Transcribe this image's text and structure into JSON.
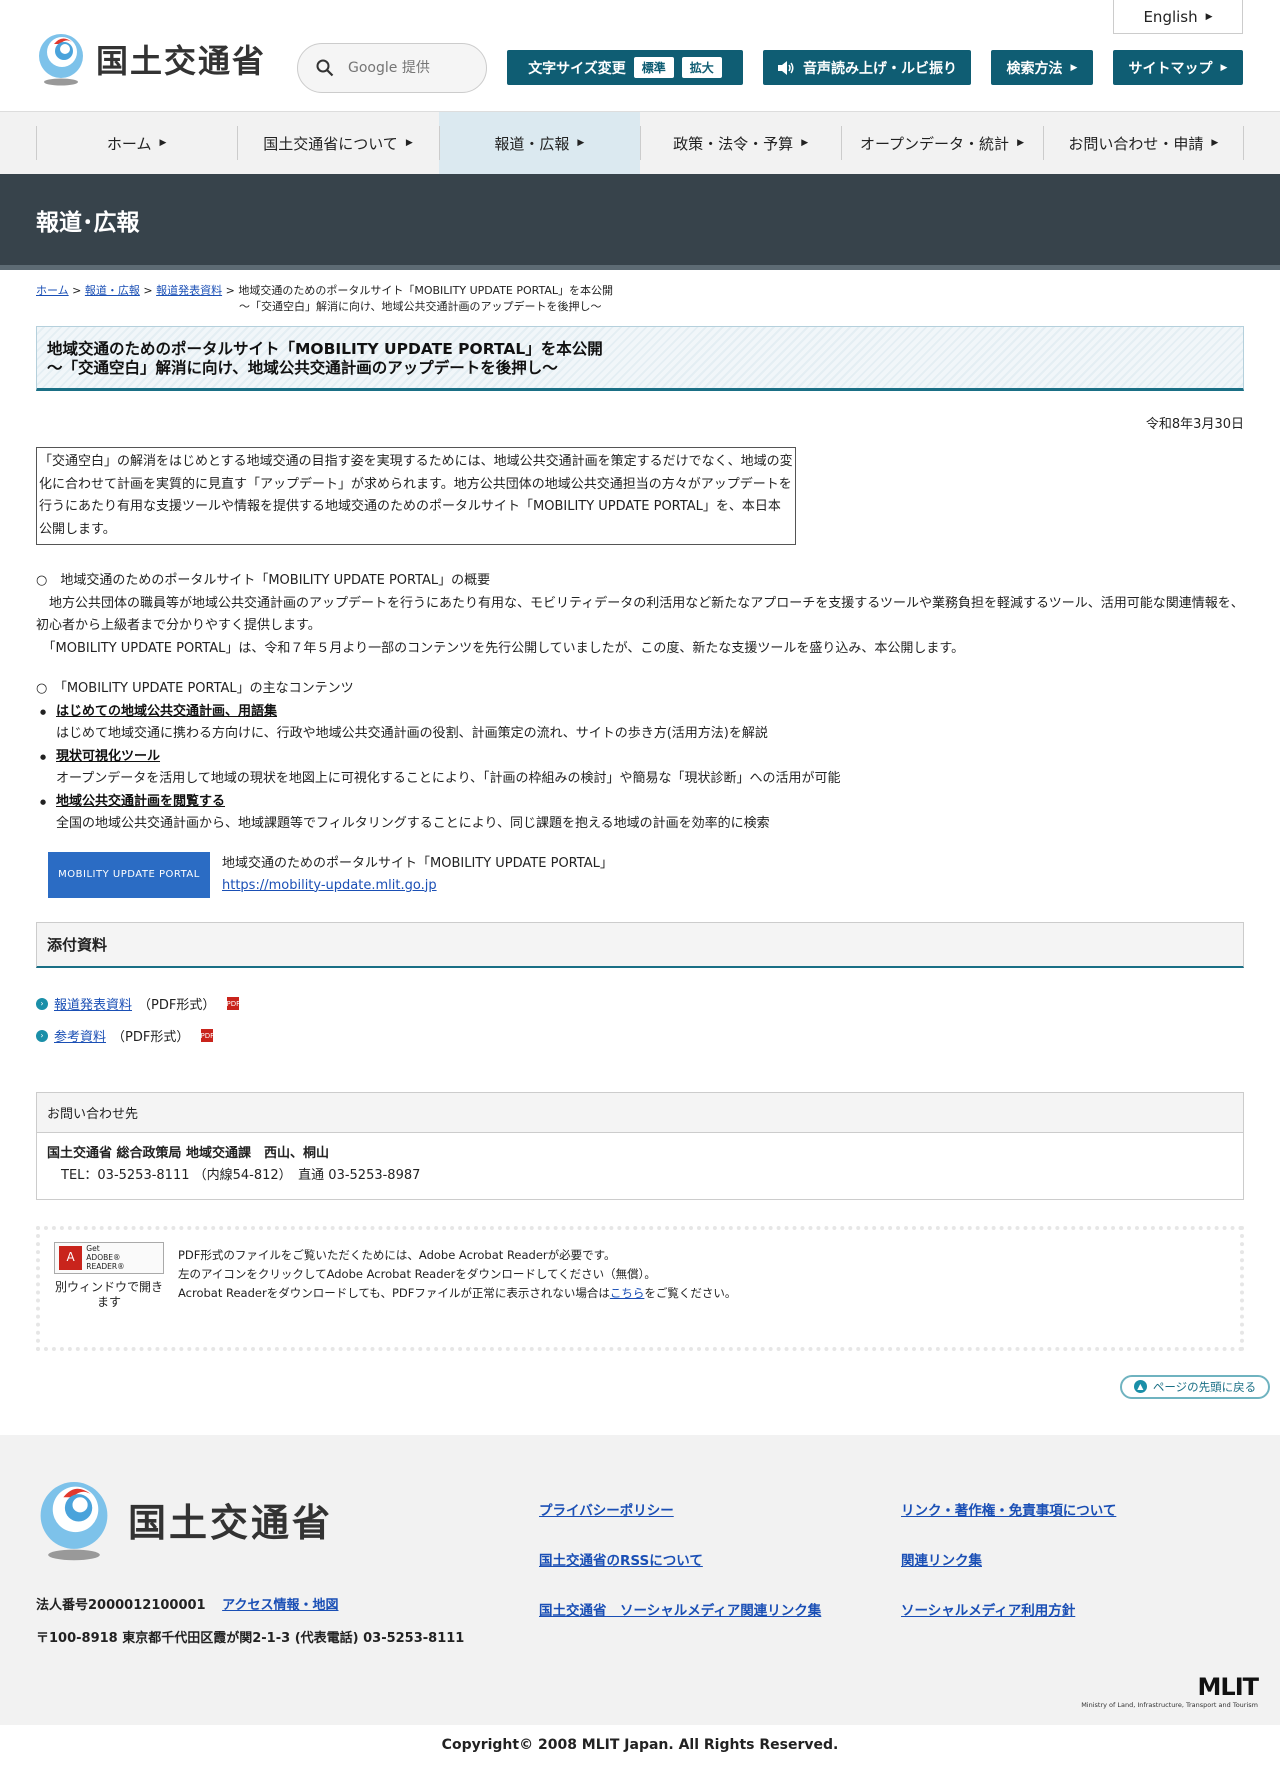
{
  "header": {
    "logo_text": "国土交通省",
    "search_placeholder": "Google 提供",
    "english": "English",
    "font_size": {
      "label": "文字サイズ変更",
      "standard": "標準",
      "large": "拡大"
    },
    "voice": "音声読み上げ・ルビ振り",
    "search_method": "検索方法",
    "sitemap": "サイトマップ"
  },
  "nav": [
    {
      "label": "ホーム"
    },
    {
      "label": "国土交通省について"
    },
    {
      "label": "報道・広報"
    },
    {
      "label": "政策・法令・予算"
    },
    {
      "label": "オープンデータ・統計"
    },
    {
      "label": "お問い合わせ・申請"
    }
  ],
  "banner_title": "報道･広報",
  "breadcrumb": {
    "home": "ホーム",
    "press": "報道・広報",
    "releases": "報道発表資料",
    "current_line1": "地域交通のためのポータルサイト「MOBILITY UPDATE PORTAL」を本公開",
    "current_line2": "～「交通空白」解消に向け、地域公共交通計画のアップデートを後押し～"
  },
  "article": {
    "title_line1": "地域交通のためのポータルサイト「MOBILITY UPDATE PORTAL」を本公開",
    "title_line2": "～「交通空白」解消に向け、地域公共交通計画のアップデートを後押し～",
    "date": "令和8年3月30日",
    "lead": "「交通空白」の解消をはじめとする地域交通の目指す姿を実現するためには、地域公共交通計画を策定するだけでなく、地域の変化に合わせて計画を実質的に見直す「アップデート」が求められます。地方公共団体の地域公共交通担当の方々がアップデートを行うにあたり有用な支援ツールや情報を提供する地域交通のためのポータルサイト「MOBILITY UPDATE PORTAL」を、本日本公開します。",
    "overview_head": "○　地域交通のためのポータルサイト「MOBILITY UPDATE PORTAL」の概要",
    "overview_p1": "　地方公共団体の職員等が地域公共交通計画のアップデートを行うにあたり有用な、モビリティデータの利活用など新たなアプローチを支援するツールや業務負担を軽減するツール、活用可能な関連情報を、初心者から上級者まで分かりやすく提供します。",
    "overview_p2": "　「MOBILITY UPDATE PORTAL」は、令和７年５月より一部のコンテンツを先行公開していましたが、この度、新たな支援ツールを盛り込み、本公開します。",
    "contents_head": "○　「MOBILITY UPDATE PORTAL」の主なコンテンツ",
    "contents": [
      {
        "title": "はじめての地域公共交通計画、用語集",
        "desc": "はじめて地域交通に携わる方向けに、行政や地域公共交通計画の役割、計画策定の流れ、サイトの歩き方(活用方法)を解説"
      },
      {
        "title": "現状可視化ツール",
        "desc": "オープンデータを活用して地域の現状を地図上に可視化することにより、「計画の枠組みの検討」や簡易な「現状診断」への活用が可能"
      },
      {
        "title": "地域公共交通計画を閲覧する",
        "desc": "全国の地域公共交通計画から、地域課題等でフィルタリングすることにより、同じ課題を抱える地域の計画を効率的に検索"
      }
    ],
    "portal_badge": "MOBILITY UPDATE PORTAL",
    "portal_name": "地域交通のためのポータルサイト「MOBILITY UPDATE PORTAL」",
    "portal_url": "https://mobility-update.mlit.go.jp"
  },
  "attachments": {
    "heading": "添付資料",
    "items": [
      {
        "label": "報道発表資料",
        "format": "（PDF形式）"
      },
      {
        "label": "参考資料",
        "format": "（PDF形式）"
      }
    ]
  },
  "contact": {
    "heading": "お問い合わせ先",
    "org": "国土交通省 総合政策局 地域交通課　西山、桐山",
    "tel": "TEL：03-5253-8111 （内線54-812）　直通 03-5253-8987"
  },
  "reader": {
    "badge_line1": "Get",
    "badge_line2": "ADOBE® READER®",
    "caption": "別ウィンドウで開きます",
    "line1": "PDF形式のファイルをご覧いただくためには、Adobe Acrobat Readerが必要です。",
    "line2": "左のアイコンをクリックしてAdobe Acrobat Readerをダウンロードしてください（無償）。",
    "line3_pre": "Acrobat Readerをダウンロードしても、PDFファイルが正常に表示されない場合は",
    "line3_link": "こちら",
    "line3_post": "をご覧ください。"
  },
  "pagetop": "ページの先頭に戻る",
  "footer": {
    "logo_text": "国土交通省",
    "corp_no": "法人番号2000012100001",
    "access": "アクセス情報・地図",
    "address": "〒100-8918 東京都千代田区霞が関2-1-3 (代表電話) 03-5253-8111",
    "links": [
      "プライバシーポリシー",
      "リンク・著作権・免責事項について",
      "国土交通省のRSSについて",
      "関連リンク集",
      "国土交通省　ソーシャルメディア関連リンク集",
      "ソーシャルメディア利用方針"
    ],
    "mlit_big": "MLIT",
    "mlit_small": "Ministry of Land, Infrastructure, Transport and Tourism",
    "copyright": "Copyright© 2008 MLIT Japan. All Rights Reserved."
  }
}
